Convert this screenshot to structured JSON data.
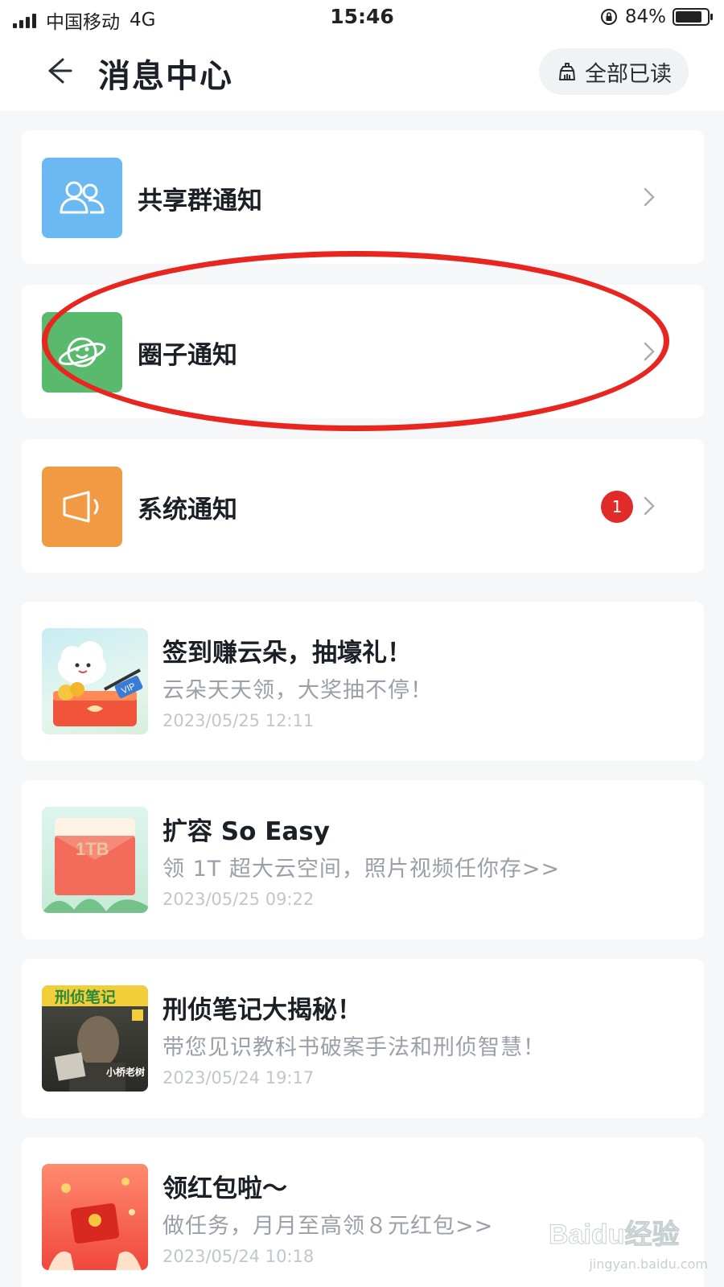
{
  "status_bar": {
    "carrier": "中国移动",
    "network": "4G",
    "time": "15:46",
    "battery": "84%",
    "battery_level": 0.84
  },
  "header": {
    "title": "消息中心",
    "read_all_label": "全部已读"
  },
  "categories": [
    {
      "label": "共享群通知",
      "icon": "shared-group-icon",
      "color": "#6ab9f2"
    },
    {
      "label": "圈子通知",
      "icon": "circle-planet-icon",
      "color": "#59b96d"
    },
    {
      "label": "系统通知",
      "icon": "speaker-icon",
      "color": "#f29a43",
      "badge": "1"
    }
  ],
  "messages": [
    {
      "title": "签到赚云朵，抽壕礼！",
      "subtitle": "云朵天天领，大奖抽不停！",
      "time": "2023/05/25 12:11",
      "thumb_text": "VIP"
    },
    {
      "title": "扩容 So Easy",
      "subtitle": "领 1T 超大云空间，照片视频任你存>>",
      "time": "2023/05/25 09:22",
      "thumb_text": "1TB"
    },
    {
      "title": "刑侦笔记大揭秘！",
      "subtitle": "带您见识教科书破案手法和刑侦智慧！",
      "time": "2023/05/24 19:17",
      "thumb_text": "刑侦笔记",
      "thumb_text2": "小桥老树"
    },
    {
      "title": "领红包啦～",
      "subtitle": "做任务，月月至高领８元红包>>",
      "time": "2023/05/24 10:18"
    }
  ],
  "watermark": {
    "brand": "Baidu经验",
    "url": "jingyan.baidu.com"
  }
}
